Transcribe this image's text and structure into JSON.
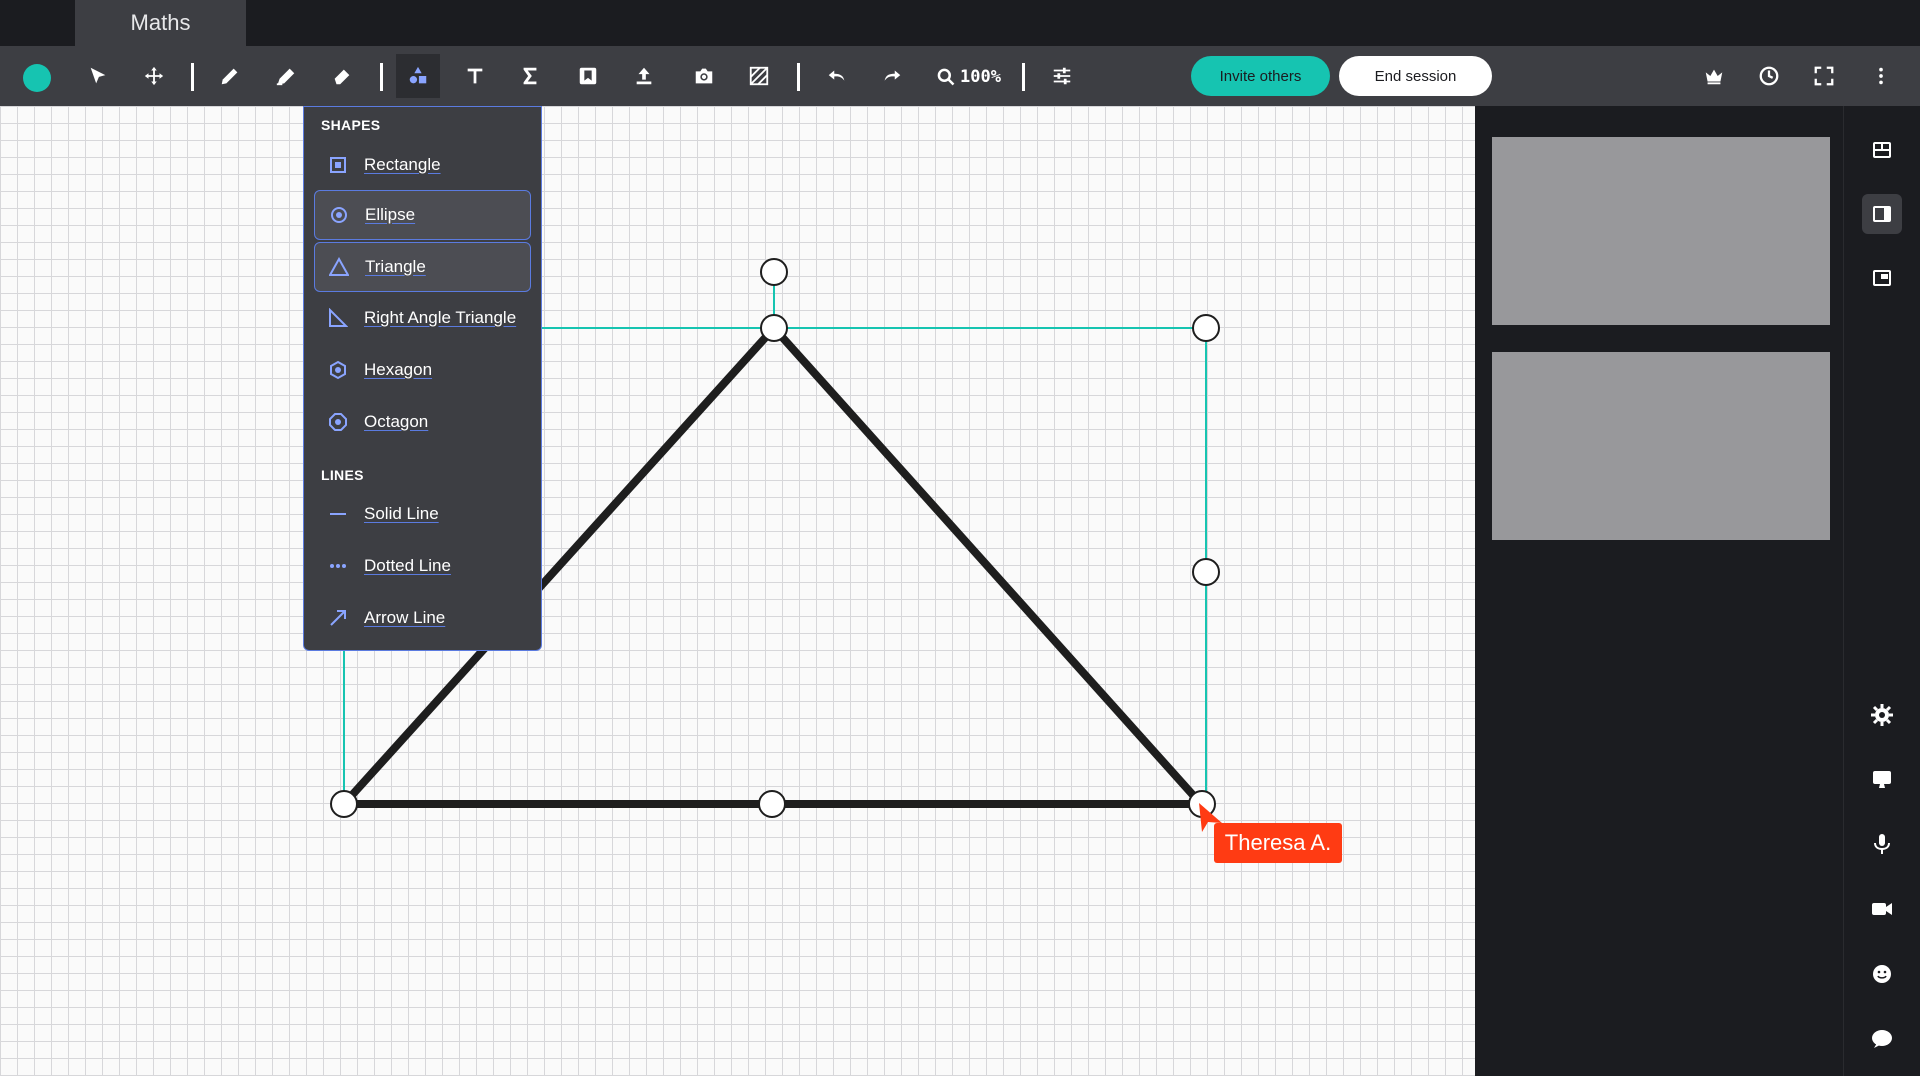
{
  "tab": {
    "title": "Maths"
  },
  "toolbar": {
    "current_color": "#16c4b1",
    "tools": [
      "select",
      "move",
      "pen",
      "highlighter",
      "eraser",
      "shapes",
      "text",
      "equation",
      "bookmark",
      "upload",
      "camera",
      "hatch",
      "undo",
      "redo",
      "zoom",
      "adjust"
    ],
    "zoom_label": "100%",
    "invite_label": "Invite others",
    "end_label": "End session"
  },
  "dropdown": {
    "shapes_header": "SHAPES",
    "shapes": [
      {
        "label": "Rectangle",
        "icon": "rectangle-icon"
      },
      {
        "label": "Ellipse",
        "icon": "ellipse-icon"
      },
      {
        "label": "Triangle",
        "icon": "triangle-icon"
      },
      {
        "label": "Right Angle Triangle",
        "icon": "right-triangle-icon"
      },
      {
        "label": "Hexagon",
        "icon": "hexagon-icon"
      },
      {
        "label": "Octagon",
        "icon": "octagon-icon"
      }
    ],
    "lines_header": "LINES",
    "lines": [
      {
        "label": "Solid Line",
        "icon": "solid-line-icon"
      },
      {
        "label": "Dotted Line",
        "icon": "dotted-line-icon"
      },
      {
        "label": "Arrow Line",
        "icon": "arrow-line-icon"
      }
    ]
  },
  "canvas": {
    "cursor_user": "Theresa A.",
    "cursor_color": "#ff3b13",
    "selection_color": "#16c4b1"
  },
  "right_rail": [
    "layout-grid-icon",
    "layout-side-icon",
    "layout-pip-icon",
    "settings-icon",
    "screen-share-icon",
    "microphone-icon",
    "camera-icon",
    "emoji-icon",
    "chat-icon"
  ]
}
